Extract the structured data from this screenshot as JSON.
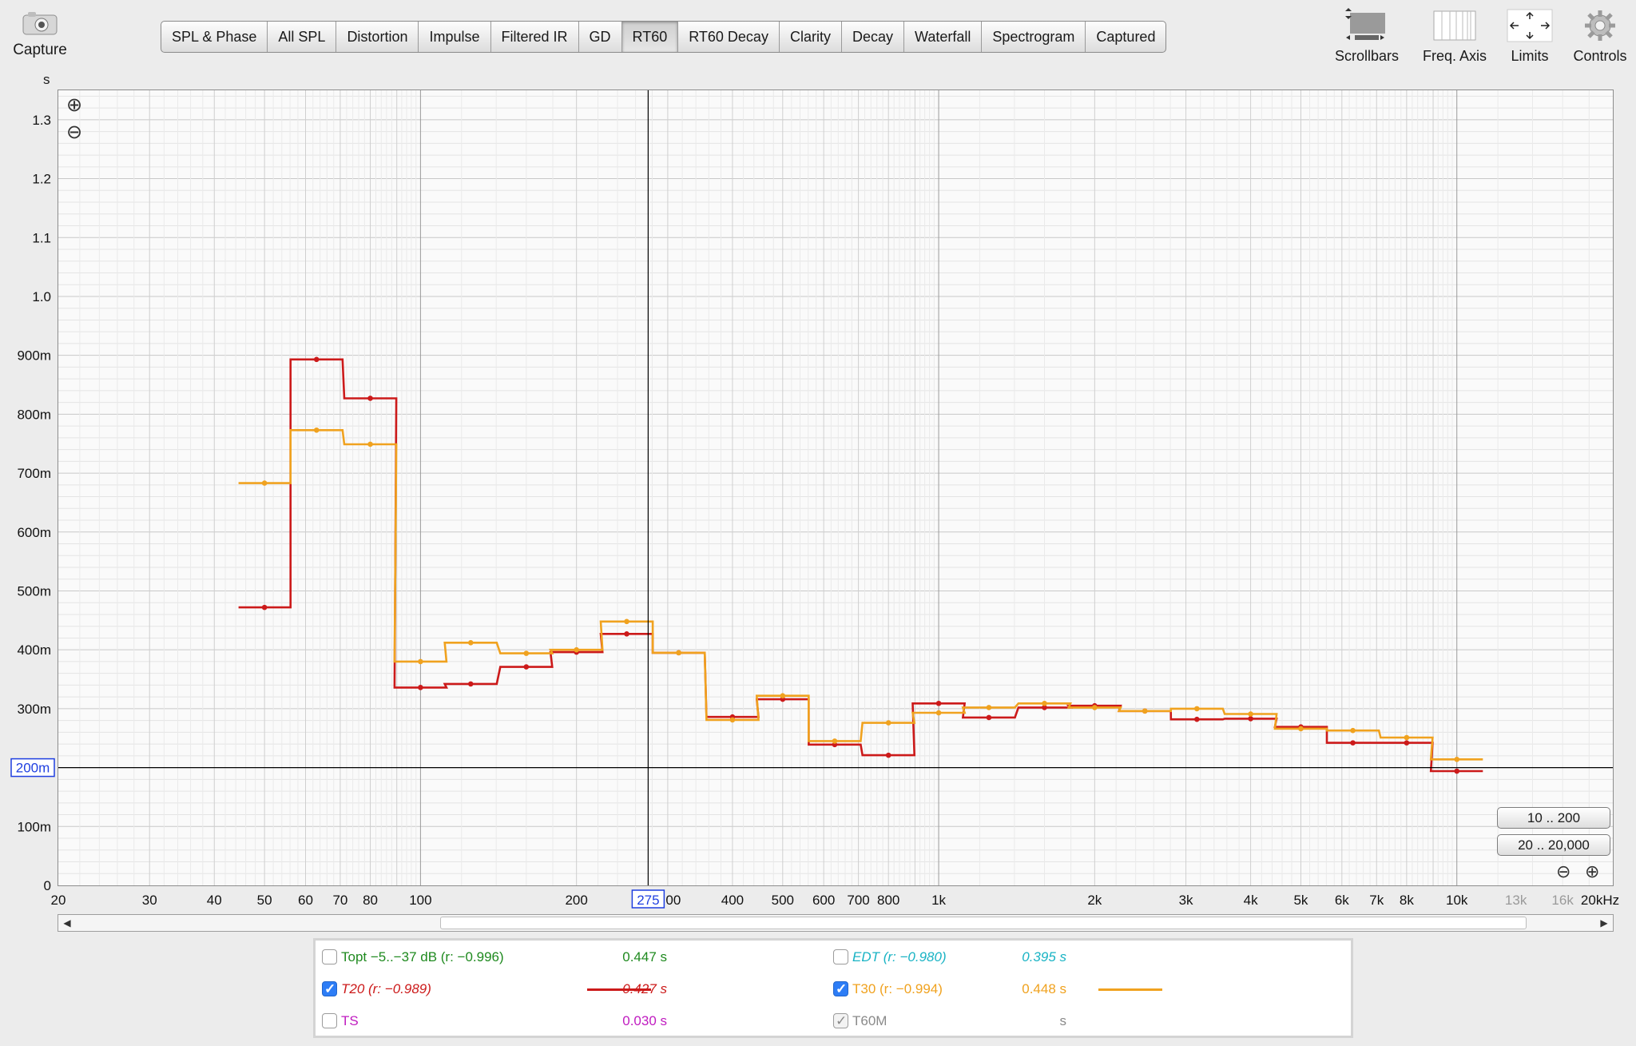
{
  "capture": {
    "label": "Capture",
    "icon": "camera-icon"
  },
  "tabs": [
    {
      "label": "SPL & Phase",
      "active": false
    },
    {
      "label": "All SPL",
      "active": false
    },
    {
      "label": "Distortion",
      "active": false
    },
    {
      "label": "Impulse",
      "active": false
    },
    {
      "label": "Filtered IR",
      "active": false
    },
    {
      "label": "GD",
      "active": false
    },
    {
      "label": "RT60",
      "active": true
    },
    {
      "label": "RT60 Decay",
      "active": false
    },
    {
      "label": "Clarity",
      "active": false
    },
    {
      "label": "Decay",
      "active": false
    },
    {
      "label": "Waterfall",
      "active": false
    },
    {
      "label": "Spectrogram",
      "active": false
    },
    {
      "label": "Captured",
      "active": false
    }
  ],
  "tools": [
    {
      "label": "Scrollbars",
      "icon": "scrollbars-icon"
    },
    {
      "label": "Freq. Axis",
      "icon": "freq-axis-icon"
    },
    {
      "label": "Limits",
      "icon": "limits-icon"
    },
    {
      "label": "Controls",
      "icon": "gear-icon"
    }
  ],
  "plot": {
    "y_unit": "s",
    "y_ticks": [
      {
        "v": 1.3,
        "t": "1.3"
      },
      {
        "v": 1.2,
        "t": "1.2"
      },
      {
        "v": 1.1,
        "t": "1.1"
      },
      {
        "v": 1.0,
        "t": "1.0"
      },
      {
        "v": 0.9,
        "t": "900m"
      },
      {
        "v": 0.8,
        "t": "800m"
      },
      {
        "v": 0.7,
        "t": "700m"
      },
      {
        "v": 0.6,
        "t": "600m"
      },
      {
        "v": 0.5,
        "t": "500m"
      },
      {
        "v": 0.4,
        "t": "400m"
      },
      {
        "v": 0.3,
        "t": "300m"
      },
      {
        "v": 0.1,
        "t": "100m"
      },
      {
        "v": 0,
        "t": "0"
      }
    ],
    "x_ticks": [
      {
        "v": 20,
        "t": "20"
      },
      {
        "v": 30,
        "t": "30"
      },
      {
        "v": 40,
        "t": "40"
      },
      {
        "v": 50,
        "t": "50"
      },
      {
        "v": 60,
        "t": "60"
      },
      {
        "v": 70,
        "t": "70"
      },
      {
        "v": 80,
        "t": "80"
      },
      {
        "v": 100,
        "t": "100"
      },
      {
        "v": 200,
        "t": "200"
      },
      {
        "v": 400,
        "t": "400"
      },
      {
        "v": 500,
        "t": "500"
      },
      {
        "v": 600,
        "t": "600"
      },
      {
        "v": 700,
        "t": "700"
      },
      {
        "v": 800,
        "t": "800"
      },
      {
        "v": 1000,
        "t": "1k"
      },
      {
        "v": 2000,
        "t": "2k"
      },
      {
        "v": 3000,
        "t": "3k"
      },
      {
        "v": 4000,
        "t": "4k"
      },
      {
        "v": 5000,
        "t": "5k"
      },
      {
        "v": 6000,
        "t": "6k"
      },
      {
        "v": 7000,
        "t": "7k"
      },
      {
        "v": 8000,
        "t": "8k"
      },
      {
        "v": 10000,
        "t": "10k"
      },
      {
        "v": 13000,
        "t": "13k",
        "dim": true
      },
      {
        "v": 16000,
        "t": "16k",
        "dim": true
      },
      {
        "v": 20000,
        "t": "20kHz"
      }
    ],
    "cursor_x_label": "275",
    "cursor_x_suffix": "00",
    "cursor_y_label": "200m",
    "range_buttons": [
      "10 .. 200",
      "20 .. 20,000"
    ]
  },
  "chart_data": {
    "type": "line",
    "xlabel": "",
    "ylabel": "s",
    "x_scale": "log",
    "xlim": [
      20,
      20000
    ],
    "ylim": [
      0,
      1.35
    ],
    "grid": true,
    "cursor": {
      "x": 275,
      "y": 0.2
    },
    "bands": [
      50,
      63,
      80,
      100,
      125,
      160,
      200,
      250,
      315,
      400,
      500,
      630,
      800,
      1000,
      1250,
      1600,
      2000,
      2500,
      3150,
      4000,
      5000,
      6300,
      8000,
      10000
    ],
    "series": [
      {
        "name": "T20 (r: -0.989)",
        "color": "#cc1a1a",
        "values": [
          0.472,
          0.893,
          0.827,
          0.336,
          0.342,
          0.371,
          0.396,
          0.427,
          0.395,
          0.286,
          0.316,
          0.239,
          0.221,
          0.309,
          0.285,
          0.302,
          0.305,
          0.296,
          0.282,
          0.283,
          0.269,
          0.242,
          0.242,
          0.194
        ]
      },
      {
        "name": "T30 (r: -0.994)",
        "color": "#f0a21f",
        "values": [
          0.683,
          0.773,
          0.749,
          0.38,
          0.412,
          0.394,
          0.4,
          0.448,
          0.395,
          0.281,
          0.322,
          0.245,
          0.276,
          0.293,
          0.302,
          0.309,
          0.302,
          0.296,
          0.3,
          0.291,
          0.266,
          0.263,
          0.251,
          0.214
        ]
      }
    ]
  },
  "legend": {
    "rows": [
      {
        "label": "Topt −5..−37 dB (r: −0.996)",
        "value": "0.447 s",
        "checked": false,
        "color": "#1f8a1f",
        "italic": false
      },
      {
        "label": "EDT (r: −0.980)",
        "value": "0.395 s",
        "checked": false,
        "color": "#19b3c4",
        "italic": true
      },
      {
        "label": "T20 (r: −0.989)",
        "value": "0.427 s",
        "checked": true,
        "color": "#cc1a1a",
        "italic": true,
        "swatch": "#cc1a1a"
      },
      {
        "label": "T30 (r: −0.994)",
        "value": "0.448 s",
        "checked": true,
        "color": "#f0a21f",
        "italic": false,
        "swatch": "#f0a21f"
      },
      {
        "label": "TS",
        "value": "0.030 s",
        "checked": false,
        "color": "#c01cc0",
        "italic": false
      },
      {
        "label": "T60M",
        "value": "s",
        "checked": "grey",
        "color": "#8a8a8a",
        "italic": false
      }
    ]
  }
}
